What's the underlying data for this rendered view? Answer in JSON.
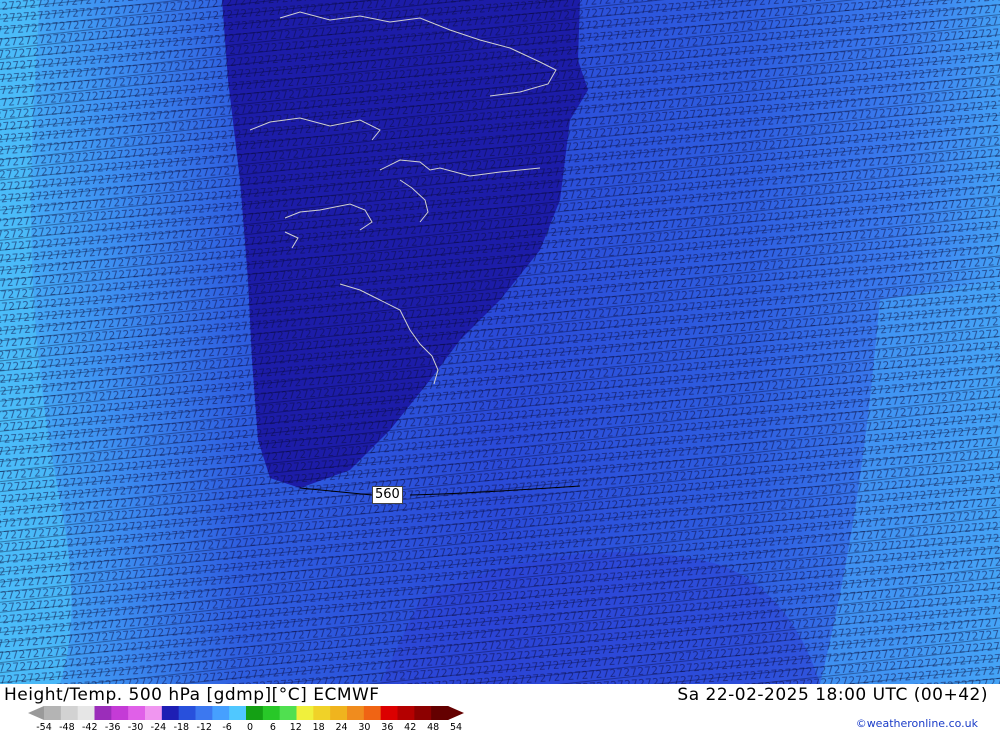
{
  "title_left": "Height/Temp. 500 hPa [gdmp][°C] ECMWF",
  "title_right": "Sa 22-02-2025 18:00 UTC (00+42)",
  "credit": "©weatheronline.co.uk",
  "contour_label": "560",
  "legend": {
    "ticks": [
      "-54",
      "-48",
      "-42",
      "-36",
      "-30",
      "-24",
      "-18",
      "-12",
      "-6",
      "0",
      "6",
      "12",
      "18",
      "24",
      "30",
      "36",
      "42",
      "48",
      "54"
    ],
    "colors": [
      "#b4b4b4",
      "#d2d2d2",
      "#e6e6e6",
      "#9b2dba",
      "#c43bd6",
      "#e060e8",
      "#f096f0",
      "#1e1eb4",
      "#2850dc",
      "#3c78f0",
      "#46a0ff",
      "#50c8ff",
      "#14a014",
      "#28c828",
      "#50e050",
      "#f0f03c",
      "#f0d228",
      "#f0b41e",
      "#f08c1e",
      "#f06414",
      "#dc0000",
      "#b40000",
      "#8c0000",
      "#640000"
    ]
  },
  "map_colors": {
    "deep": "#1c1ca8",
    "mid": "#2a48dc",
    "light": "#3c78f0",
    "cyan": "#46a8f8",
    "coast": "#c8c8c8"
  }
}
